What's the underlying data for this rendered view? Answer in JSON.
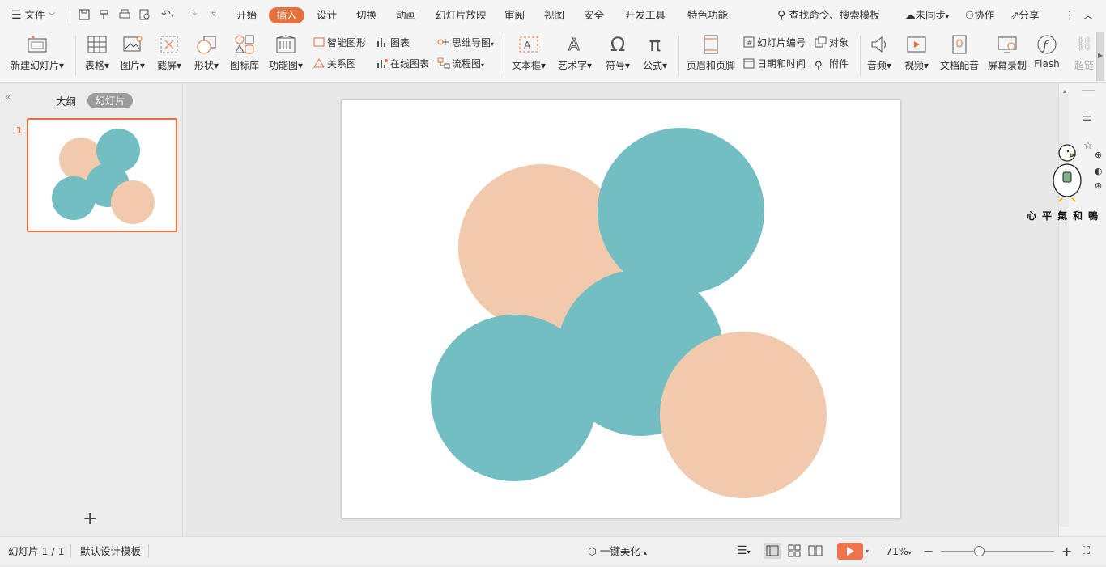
{
  "menubar": {
    "file_label": "文件",
    "tabs": [
      "开始",
      "插入",
      "设计",
      "切换",
      "动画",
      "幻灯片放映",
      "审阅",
      "视图",
      "安全",
      "开发工具",
      "特色功能"
    ],
    "search_placeholder": "查找命令、搜索模板",
    "sync_label": "未同步",
    "collab_label": "协作",
    "share_label": "分享"
  },
  "ribbon": {
    "new_slide": "新建幻灯片",
    "table": "表格",
    "picture": "图片",
    "screenshot": "截屏",
    "shape": "形状",
    "icon_lib": "图标库",
    "func_chart": "功能图",
    "smart_art": "智能图形",
    "chart": "图表",
    "mind_map": "思维导图",
    "relation": "关系图",
    "online_chart": "在线图表",
    "flowchart": "流程图",
    "textbox": "文本框",
    "wordart": "艺术字",
    "symbol": "符号",
    "formula": "公式",
    "header_footer": "页眉和页脚",
    "slide_number": "幻灯片编号",
    "object": "对象",
    "datetime": "日期和时间",
    "attachment": "附件",
    "audio": "音频",
    "video": "视频",
    "voiceover": "文档配音",
    "screen_record": "屏幕录制",
    "flash": "Flash",
    "hyperlink": "超链"
  },
  "left_panel": {
    "tab_outline": "大纲",
    "tab_slides": "幻灯片",
    "slide_number": "1",
    "add_symbol": "+"
  },
  "slide": {
    "colors": {
      "peach": "#f1c9ac",
      "teal": "#73bec3"
    }
  },
  "watermark": {
    "text": "心平氣和鴨"
  },
  "statusbar": {
    "slide_count": "幻灯片 1 / 1",
    "template": "默认设计模板",
    "beautify": "一键美化",
    "zoom": "71%"
  },
  "colors": {
    "accent": "#e8703a"
  }
}
